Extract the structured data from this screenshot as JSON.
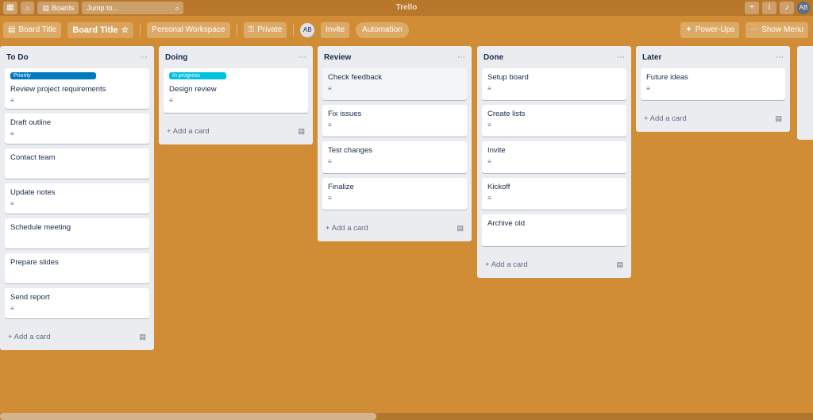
{
  "topbar": {
    "home_icon": "home-icon",
    "boards_label": "Boards",
    "search_placeholder": "Jump to...",
    "logo_text": "Trello",
    "create_icon": "+",
    "info_icon": "i",
    "bell_icon": "bell-icon",
    "avatar_initials": "AB"
  },
  "boardbar": {
    "board_title": "Board Title",
    "star_icon": "star-icon",
    "workspace_label": "Personal Workspace",
    "visibility_label": "Private",
    "member_initials": "AB",
    "invite_label": "Invite",
    "automation_label": "Automation",
    "menu_label": "Show Menu",
    "power_ups_label": "Power-Ups"
  },
  "lists": [
    {
      "title": "To Do",
      "cards": [
        {
          "label": "Priority",
          "label_color": "#0079bf",
          "title": "Review project requirements",
          "badge": "≡"
        },
        {
          "label": "",
          "label_color": "",
          "title": "Draft outline",
          "badge": "≡"
        },
        {
          "label": "",
          "label_color": "",
          "title": "Contact team",
          "badge": ""
        },
        {
          "label": "",
          "label_color": "",
          "title": "Update notes",
          "badge": "≡"
        },
        {
          "label": "",
          "label_color": "",
          "title": "Schedule meeting",
          "badge": ""
        },
        {
          "label": "",
          "label_color": "",
          "title": "Prepare slides",
          "badge": ""
        },
        {
          "label": "",
          "label_color": "",
          "title": "Send report",
          "badge": "≡"
        }
      ],
      "add_label": "+ Add a card",
      "template_icon": "▤"
    },
    {
      "title": "Doing",
      "cards": [
        {
          "label": "In progress",
          "label_color": "#00c2e0",
          "title": "Design review",
          "badge": "≡"
        }
      ],
      "add_label": "+ Add a card",
      "template_icon": "▤"
    },
    {
      "title": "Review",
      "cards": [
        {
          "label": "",
          "label_color": "",
          "title": "Check feedback",
          "badge": "≡"
        },
        {
          "label": "",
          "label_color": "",
          "title": "Fix issues",
          "badge": "≡"
        },
        {
          "label": "",
          "label_color": "",
          "title": "Test changes",
          "badge": "≡"
        },
        {
          "label": "",
          "label_color": "",
          "title": "Finalize",
          "badge": "≡"
        }
      ],
      "add_label": "+ Add a card",
      "template_icon": "▤"
    },
    {
      "title": "Done",
      "cards": [
        {
          "label": "",
          "label_color": "",
          "title": "Setup board",
          "badge": "≡"
        },
        {
          "label": "",
          "label_color": "",
          "title": "Create lists",
          "badge": "≡"
        },
        {
          "label": "",
          "label_color": "",
          "title": "Invite",
          "badge": "≡"
        },
        {
          "label": "",
          "label_color": "",
          "title": "Kickoff",
          "badge": "≡"
        },
        {
          "label": "",
          "label_color": "",
          "title": "Archive old",
          "badge": ""
        }
      ],
      "add_label": "+ Add a card",
      "template_icon": "▤"
    },
    {
      "title": "Later",
      "cards": [
        {
          "label": "",
          "label_color": "",
          "title": "Future ideas",
          "badge": "≡"
        }
      ],
      "add_label": "+ Add a card",
      "template_icon": "▤"
    }
  ],
  "colors": {
    "background": "#d08d35",
    "list_bg": "#ebecf0",
    "card_bg": "#ffffff"
  }
}
